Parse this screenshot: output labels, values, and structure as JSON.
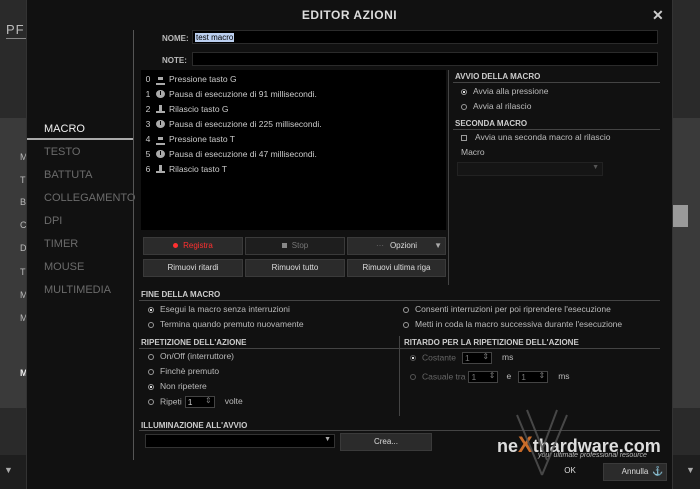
{
  "window": {
    "title": "EDITOR AZIONI",
    "close": "✕"
  },
  "background": {
    "title": "PF"
  },
  "nav": {
    "items": [
      {
        "label": "MACRO",
        "active": true
      },
      {
        "label": "TESTO"
      },
      {
        "label": "BATTUTA"
      },
      {
        "label": "COLLEGAMENTO"
      },
      {
        "label": "DPI"
      },
      {
        "label": "TIMER"
      },
      {
        "label": "MOUSE"
      },
      {
        "label": "MULTIMEDIA"
      }
    ]
  },
  "form": {
    "name_label": "NOME:",
    "name_value": "test macro",
    "notes_label": "NOTE:",
    "notes_value": ""
  },
  "actions": [
    {
      "index": "0",
      "icon": "key-press-icon",
      "text": "Pressione tasto G"
    },
    {
      "index": "1",
      "icon": "pause-clock-icon",
      "text": "Pausa di esecuzione di 91 millisecondi."
    },
    {
      "index": "2",
      "icon": "key-release-icon",
      "text": "Rilascio tasto G"
    },
    {
      "index": "3",
      "icon": "pause-clock-icon",
      "text": "Pausa di esecuzione di 225 millisecondi."
    },
    {
      "index": "4",
      "icon": "key-press-icon",
      "text": "Pressione tasto T"
    },
    {
      "index": "5",
      "icon": "pause-clock-icon",
      "text": "Pausa di esecuzione di 47 millisecondi."
    },
    {
      "index": "6",
      "icon": "key-release-icon",
      "text": "Rilascio tasto T"
    }
  ],
  "toolbar": {
    "record": "Registra",
    "stop": "Stop",
    "options": "Opzioni",
    "remove_delays": "Rimuovi ritardi",
    "remove_all": "Rimuovi tutto",
    "remove_last": "Rimuovi ultima riga"
  },
  "avvio": {
    "title": "AVVIO DELLA MACRO",
    "on_press": "Avvia alla pressione",
    "on_release": "Avvia al rilascio"
  },
  "seconda": {
    "title": "SECONDA MACRO",
    "checkbox": "Avvia una seconda macro al rilascio",
    "macro_label": "Macro"
  },
  "fine": {
    "title": "FINE DELLA MACRO",
    "opt1": "Esegui la macro senza interruzioni",
    "opt2": "Termina quando premuto nuovamente",
    "opt3": "Consenti interruzioni per poi riprendere l'esecuzione",
    "opt4": "Metti in coda la macro successiva durante l'esecuzione"
  },
  "ripetizione": {
    "title": "RIPETIZIONE DELL'AZIONE",
    "opt1": "On/Off (interruttore)",
    "opt2": "Finchè premuto",
    "opt3": "Non ripetere",
    "opt4": "Ripeti",
    "repeat_value": "1",
    "times": "volte"
  },
  "ritardo": {
    "title": "RITARDO PER LA RIPETIZIONE DELL'AZIONE",
    "constant": "Costante",
    "constant_value": "1",
    "ms": "ms",
    "random": "Casuale tra",
    "random_min": "1",
    "and": "e",
    "random_max": "1",
    "ms2": "ms"
  },
  "illuminazione": {
    "title": "ILLUMINAZIONE ALL'AVVIO",
    "create": "Crea..."
  },
  "footer": {
    "ok": "OK",
    "cancel": "Annulla"
  },
  "watermark": {
    "brand_left": "ne",
    "brand_x": "X",
    "brand_right": "thardware.com",
    "tagline": "your ultimate professional resource"
  }
}
